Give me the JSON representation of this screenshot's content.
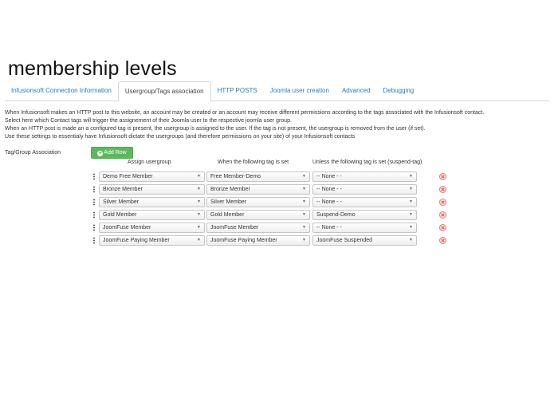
{
  "page_title": "membership levels",
  "tabs": [
    {
      "label": "Infusionsoft Connection Information",
      "active": false
    },
    {
      "label": "Usergroup/Tags association",
      "active": true
    },
    {
      "label": "HTTP POSTS",
      "active": false
    },
    {
      "label": "Joomla user creation",
      "active": false
    },
    {
      "label": "Advanced",
      "active": false
    },
    {
      "label": "Debugging",
      "active": false
    }
  ],
  "description": [
    "When Infusionsoft makes an HTTP post to this website, an account may be created or an account may receive different permissions according to the tags associated with the Infusionsoft contact.",
    "Select here which Contact tags will trigger the assignement of their Joomla user to the respective joomla user group.",
    "When an HTTP post is made an a configured tag is present, the usergroup is assigned to the user. If the tag is not present, the usergroup is removed from the user (if set).",
    "Use these settings to essentialy have Infusionsoft dictate the usergroups (and therefore permissions on your site) of your Infusionsoft contacts"
  ],
  "association": {
    "label": "Tag/Group Association",
    "add_row_label": "Add Row",
    "columns": [
      "Assign usergroup",
      "When the following tag is set",
      "Unless the following tag is set (suspend-tag)"
    ],
    "rows": [
      {
        "usergroup": "Demo Free Member",
        "tag": "Free Member-Demo",
        "suspend_tag": "-- None - -"
      },
      {
        "usergroup": "Bronze Member",
        "tag": "Bronze Member",
        "suspend_tag": "-- None - -"
      },
      {
        "usergroup": "Silver Member",
        "tag": "Silver Member",
        "suspend_tag": "-- None - -"
      },
      {
        "usergroup": "Gold Member",
        "tag": "Gold Member",
        "suspend_tag": "Suspend-Demo"
      },
      {
        "usergroup": "JoomFuse Member",
        "tag": "JoomFuse Member",
        "suspend_tag": "-- None - -"
      },
      {
        "usergroup": "JoomFuse Paying Member",
        "tag": "JoomFuse Paying Member",
        "suspend_tag": "JoomFuse Suspended"
      }
    ]
  },
  "colors": {
    "link": "#2f7ab7",
    "add_button": "#5cb85c",
    "delete_icon": "#d9534f"
  }
}
